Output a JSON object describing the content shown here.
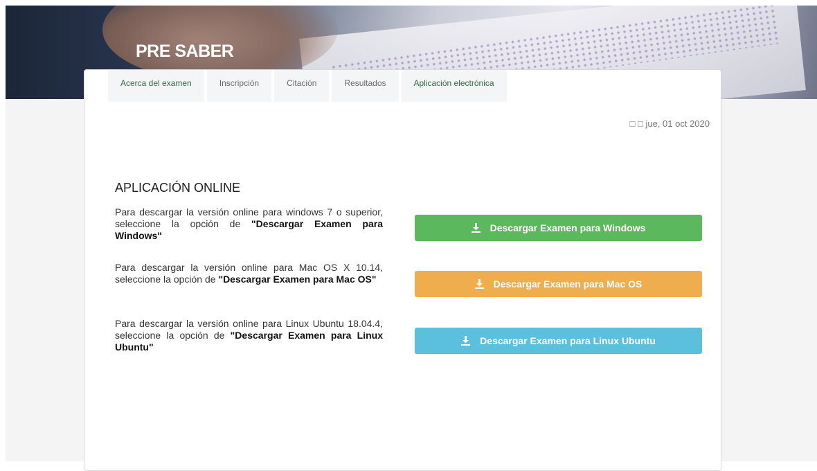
{
  "header": {
    "title": "PRE SABER"
  },
  "tabs": [
    {
      "label": "Acerca del examen"
    },
    {
      "label": "Inscripción"
    },
    {
      "label": "Citación"
    },
    {
      "label": "Resultados"
    },
    {
      "label": "Aplicación electrónica"
    }
  ],
  "date": {
    "text": "□ □ jue, 01 oct 2020"
  },
  "main": {
    "heading": "APLICACIÓN ONLINE",
    "windows": {
      "text": "Para descargar la versión online para windows 7 o superior, seleccione la opción de ",
      "option": "\"Descargar Examen para Windows\"",
      "button": "Descargar Examen para Windows",
      "color": "#5cb85c"
    },
    "mac": {
      "text": "Para descargar la versión online para Mac OS X 10.14, seleccione la opción de ",
      "option": "\"Descargar Examen para Mac OS\"",
      "button": "Descargar Examen para Mac OS",
      "color": "#f0ad4e"
    },
    "linux": {
      "text": "Para descargar la versión online para Linux Ubuntu 18.04.4, seleccione la opción de ",
      "option": "\"Descargar Examen para Linux Ubuntu\"",
      "button": "Descargar Examen para Linux Ubuntu",
      "color": "#5bc0de"
    }
  }
}
